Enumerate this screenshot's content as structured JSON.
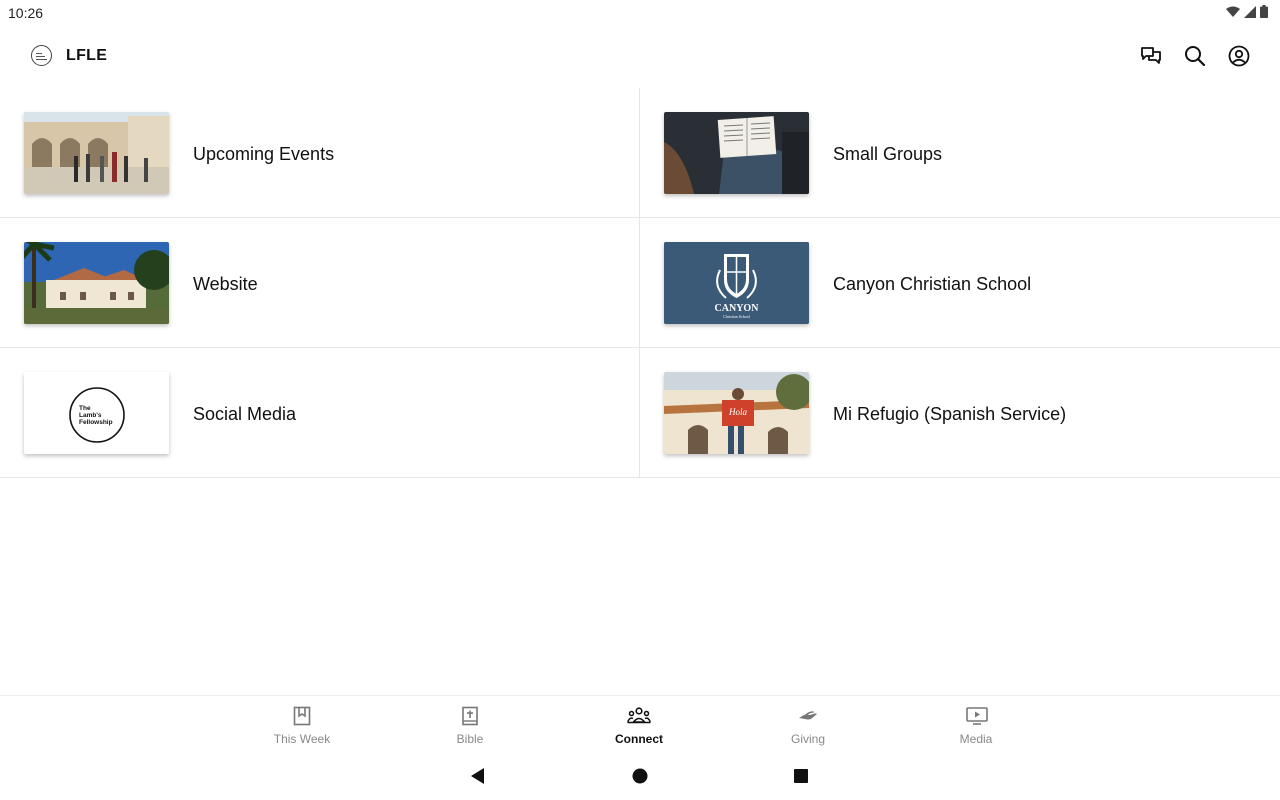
{
  "status_bar": {
    "time": "10:26"
  },
  "app": {
    "title": "LFLE"
  },
  "tiles": [
    {
      "label": "Upcoming Events"
    },
    {
      "label": "Small Groups"
    },
    {
      "label": "Website"
    },
    {
      "label": "Canyon Christian School",
      "thumb_text": "CANYON",
      "thumb_subtext": "Christian School"
    },
    {
      "label": "Social Media",
      "thumb_lines": [
        "The",
        "Lamb's",
        "Fellowship"
      ]
    },
    {
      "label": "Mi Refugio (Spanish Service)",
      "thumb_text": "Hola"
    }
  ],
  "bottom_nav": [
    {
      "label": "This Week",
      "icon": "bookmark-icon"
    },
    {
      "label": "Bible",
      "icon": "bible-icon"
    },
    {
      "label": "Connect",
      "icon": "people-icon",
      "active": true
    },
    {
      "label": "Giving",
      "icon": "giving-hand-icon"
    },
    {
      "label": "Media",
      "icon": "play-screen-icon"
    }
  ],
  "colors": {
    "school_blue": "#3b5a78",
    "active_text": "#111111",
    "inactive_text": "#888888"
  }
}
